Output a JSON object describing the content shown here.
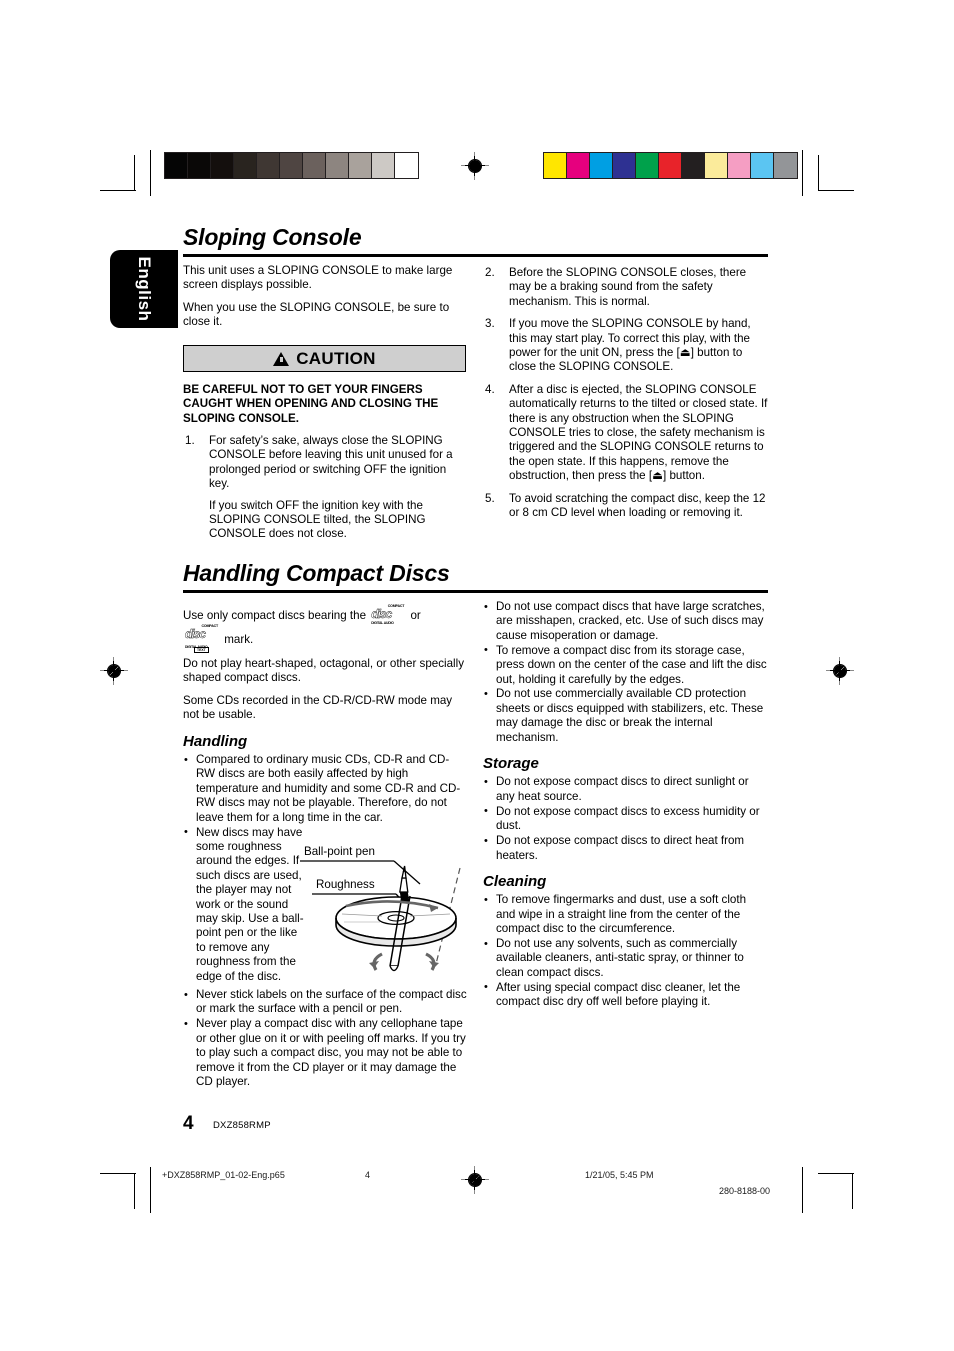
{
  "document": {
    "language_tab": "English",
    "page_number": "4",
    "model": "DXZ858RMP"
  },
  "print_marks": {
    "grayscale_bar": [
      "#050505",
      "#0a0807",
      "#140f0d",
      "#29241f",
      "#3f3733",
      "#4f4542",
      "#6b615d",
      "#8d8580",
      "#a9a29c",
      "#cdc9c5",
      "#ffffff"
    ],
    "color_bar": [
      "#ffe600",
      "#e6007e",
      "#009fe3",
      "#2e3192",
      "#00a14b",
      "#e8232a",
      "#231f20",
      "#fbeb9b",
      "#f59ec3",
      "#5bc5f2",
      "#939598"
    ]
  },
  "sections": [
    {
      "id": "sloping-console",
      "title": "Sloping Console",
      "left_column": {
        "paragraphs": [
          "This unit uses a SLOPING CONSOLE to make large screen displays possible.",
          "When you use the SLOPING CONSOLE, be sure to close it."
        ],
        "caution": {
          "title": "CAUTION",
          "lead": "BE CAREFUL NOT TO GET YOUR FINGERS CAUGHT WHEN OPENING AND CLOSING THE SLOPING CONSOLE."
        },
        "items": [
          {
            "num": "1.",
            "paragraphs": [
              "For safety’s sake, always close the SLOPING CONSOLE before leaving this unit unused for a prolonged period or switching OFF the ignition key.",
              "If you switch OFF the ignition key with the SLOPING CONSOLE tilted, the SLOPING CONSOLE does not close."
            ]
          }
        ]
      },
      "right_column": {
        "items": [
          {
            "num": "2.",
            "paragraphs": [
              "Before the SLOPING CONSOLE closes, there may be a braking sound from the safety mechanism. This is normal."
            ]
          },
          {
            "num": "3.",
            "paragraphs": [
              "If you move the SLOPING CONSOLE by hand, this may start play. To correct this play, with the power for the unit ON, press the [⏏] button to close the SLOPING CONSOLE."
            ]
          },
          {
            "num": "4.",
            "paragraphs": [
              "After a disc is ejected, the SLOPING CONSOLE automatically returns to the tilted or closed state. If there is any obstruction when the SLOPING CONSOLE tries to close, the safety mechanism is triggered and the SLOPING CONSOLE returns to the open state. If this happens, remove the obstruction, then press the [⏏] button."
            ]
          },
          {
            "num": "5.",
            "paragraphs": [
              "To avoid scratching the compact disc, keep the 12 or 8 cm CD level when loading or removing it."
            ]
          }
        ]
      }
    },
    {
      "id": "handling-compact-discs",
      "title": "Handling Compact Discs",
      "left_column": {
        "intro_before_logo": "Use only compact discs bearing the",
        "intro_middle": "or",
        "intro_after_logo": "mark.",
        "paragraphs": [
          "Do not play heart-shaped, octagonal, or other specially shaped compact discs.",
          "Some CDs recorded in the CD-R/CD-RW mode may not be usable."
        ],
        "subsection_title": "Handling",
        "bullets": [
          "Compared to ordinary music CDs, CD-R and CD-RW discs are both easily affected by high temperature and humidity and some CD-R and CD-RW discs may not be playable. Therefore, do not leave them for a long time in the car.",
          "New discs may have some roughness around the edges. If such discs are used, the player may not work or the sound may skip. Use a ball-point pen or the like to remove any roughness from the edge of the disc.",
          "Never stick labels on the surface of the compact disc or mark the surface with a pencil or pen.",
          "Never play a compact disc with any cellophane tape or other glue on it or with peeling off marks. If you try to play such a compact disc, you may not be able to remove it from the CD player or it may damage the CD player."
        ],
        "illustration": {
          "label_pen": "Ball-point pen",
          "label_roughness": "Roughness"
        }
      },
      "right_column": {
        "bullets": [
          "Do not use compact discs that have large scratches, are misshapen, cracked, etc. Use of such discs may cause misoperation or damage.",
          "To remove a compact disc from its storage case, press down on the center of the case and lift the disc out, holding it carefully by the edges.",
          "Do not use commercially available CD protection sheets or discs equipped with stabilizers, etc. These may damage the disc or break the internal mechanism."
        ],
        "storage": {
          "title": "Storage",
          "bullets": [
            "Do not expose compact discs to direct sunlight or any heat source.",
            "Do not expose compact discs to excess humidity or dust.",
            "Do not expose compact discs to direct heat from heaters."
          ]
        },
        "cleaning": {
          "title": "Cleaning",
          "bullets": [
            "To remove fingermarks and dust, use a soft cloth and wipe in a straight line from the center of the compact disc to the circumference.",
            "Do not use any solvents, such as commercially available cleaners, anti-static spray, or thinner to clean compact discs.",
            "After using special compact disc cleaner, let the compact disc dry off well before playing it."
          ]
        }
      }
    }
  ],
  "cd_logo": {
    "top": "COMPACT",
    "word": "disc",
    "bottom_audio": "DIGITAL AUDIO",
    "bottom_text_1": "DIGITAL AUDIO",
    "bottom_text_2": "TEXT"
  },
  "print_footer": {
    "filename": "+DXZ858RMP_01-02-Eng.p65",
    "page": "4",
    "timestamp": "1/21/05, 5:45 PM",
    "doc_code": "280-8188-00"
  }
}
